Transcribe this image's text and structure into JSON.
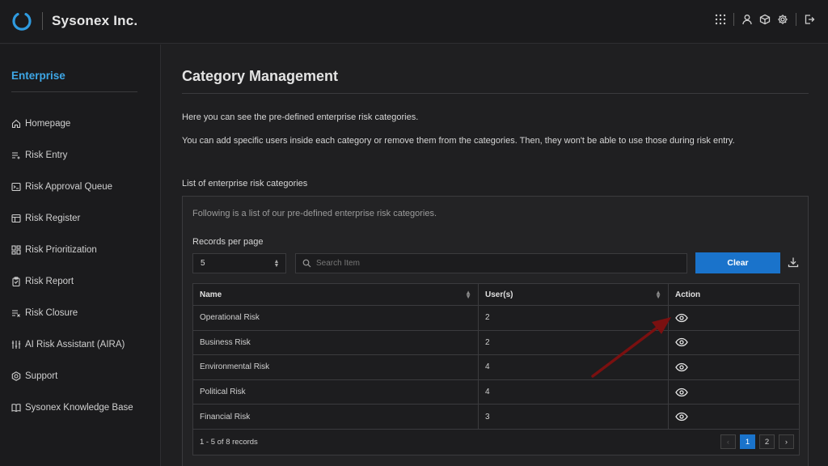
{
  "app": {
    "brand": "Sysonex Inc."
  },
  "topbar": {
    "icons": [
      "apps-grid-icon",
      "user-icon",
      "cube-icon",
      "settings-icon",
      "logout-icon"
    ]
  },
  "sidebar": {
    "title": "Enterprise",
    "items": [
      {
        "label": "Homepage",
        "icon": "home-icon"
      },
      {
        "label": "Risk Entry",
        "icon": "list-add-icon"
      },
      {
        "label": "Risk Approval Queue",
        "icon": "terminal-icon"
      },
      {
        "label": "Risk Register",
        "icon": "table-icon"
      },
      {
        "label": "Risk Prioritization",
        "icon": "dashboard-icon"
      },
      {
        "label": "Risk Report",
        "icon": "clipboard-icon"
      },
      {
        "label": "Risk Closure",
        "icon": "list-remove-icon"
      },
      {
        "label": "AI Risk Assistant (AIRA)",
        "icon": "sliders-icon"
      },
      {
        "label": "Support",
        "icon": "support-icon"
      },
      {
        "label": "Sysonex Knowledge Base",
        "icon": "book-icon"
      }
    ]
  },
  "main": {
    "title": "Category Management",
    "desc1": "Here you can see the pre-defined enterprise risk categories.",
    "desc2": "You can add specific users inside each category or remove them from the categories. Then, they won't be able to use those during risk entry.",
    "list_label": "List of enterprise risk categories",
    "panel": {
      "description": "Following is a list of our pre-defined enterprise risk categories.",
      "records_label": "Records per page",
      "records_value": "5",
      "search_placeholder": "Search Item",
      "clear_label": "Clear",
      "columns": [
        "Name",
        "User(s)",
        "Action"
      ],
      "rows": [
        {
          "name": "Operational Risk",
          "users": "2"
        },
        {
          "name": "Business Risk",
          "users": "2"
        },
        {
          "name": "Environmental Risk",
          "users": "4"
        },
        {
          "name": "Political Risk",
          "users": "4"
        },
        {
          "name": "Financial Risk",
          "users": "3"
        }
      ],
      "footer_text": "1 - 5 of 8 records",
      "pages": [
        "1",
        "2"
      ],
      "active_page": "1"
    }
  },
  "colors": {
    "accent": "#3ea7e6",
    "button": "#1a73cb",
    "annotation_arrow": "#7a1010"
  }
}
